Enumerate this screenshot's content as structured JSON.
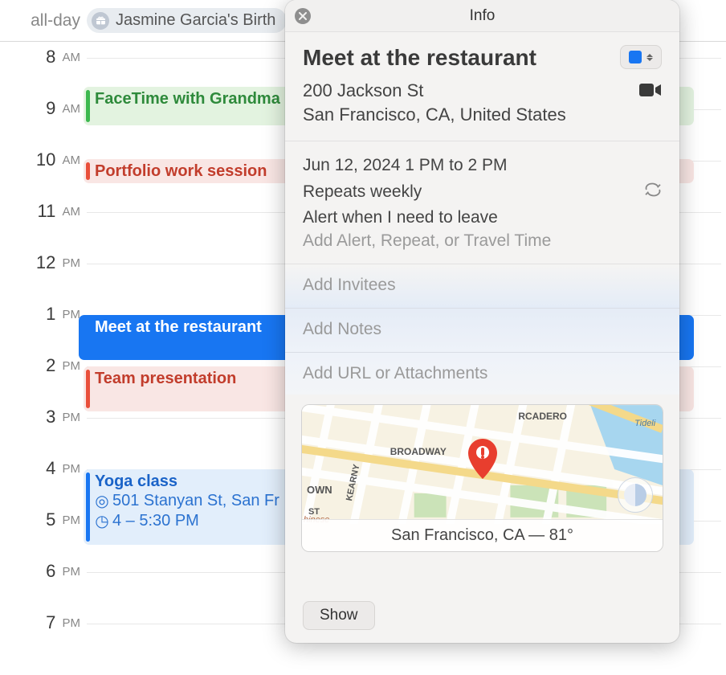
{
  "allDay": {
    "label": "all-day",
    "event": "Jasmine Garcia's Birth"
  },
  "hours": [
    {
      "num": "8",
      "ampm": "AM"
    },
    {
      "num": "9",
      "ampm": "AM"
    },
    {
      "num": "10",
      "ampm": "AM"
    },
    {
      "num": "11",
      "ampm": "AM"
    },
    {
      "num": "12",
      "ampm": "PM"
    },
    {
      "num": "1",
      "ampm": "PM"
    },
    {
      "num": "2",
      "ampm": "PM"
    },
    {
      "num": "3",
      "ampm": "PM"
    },
    {
      "num": "4",
      "ampm": "PM"
    },
    {
      "num": "5",
      "ampm": "PM"
    },
    {
      "num": "6",
      "ampm": "PM"
    },
    {
      "num": "7",
      "ampm": "PM"
    }
  ],
  "events": {
    "facetime": {
      "title": "FaceTime with Grandma"
    },
    "portfolio": {
      "title": "Portfolio work session"
    },
    "meet": {
      "title": "Meet at the restaurant"
    },
    "team": {
      "title": "Team presentation"
    },
    "yoga": {
      "title": "Yoga class",
      "location": "501 Stanyan St, San Fr",
      "time": "4 – 5:30 PM"
    }
  },
  "popover": {
    "headerTitle": "Info",
    "title": "Meet at the restaurant",
    "addressLine1": "200 Jackson St",
    "addressLine2": "San Francisco, CA, United States",
    "datetime": "Jun 12, 2024  1 PM to 2 PM",
    "repeats": "Repeats weekly",
    "alert": "Alert when I need to leave",
    "addAlert": "Add Alert, Repeat, or Travel Time",
    "addInvitees": "Add Invitees",
    "addNotes": "Add Notes",
    "addUrl": "Add URL or Attachments",
    "mapFooter": "San Francisco, CA — 81°",
    "mapLabels": {
      "broadway": "BROADWAY",
      "kearny": "KEARNY",
      "rcadero": "RCADERO",
      "own": "OWN",
      "st": "ST",
      "tideli": "Tideli",
      "chinese": "hinese"
    },
    "showBtn": "Show"
  }
}
